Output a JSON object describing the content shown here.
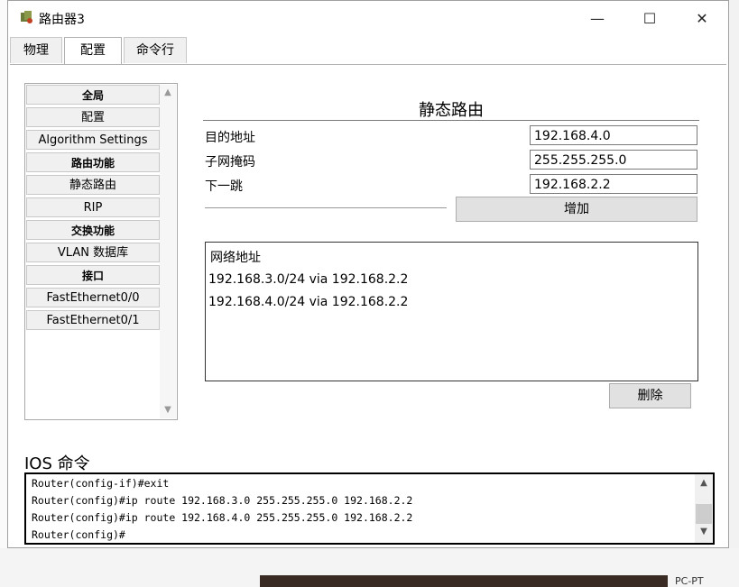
{
  "window": {
    "title": "路由器3",
    "icon": "router-icon",
    "controls": {
      "minimize": "—",
      "maximize": "☐",
      "close": "✕"
    }
  },
  "tabs": [
    {
      "label": "物理"
    },
    {
      "label": "配置"
    },
    {
      "label": "命令行"
    }
  ],
  "active_tab": "配置",
  "sidebar": {
    "items": [
      {
        "label": "全局",
        "type": "header"
      },
      {
        "label": "配置",
        "type": "item"
      },
      {
        "label": "Algorithm Settings",
        "type": "item"
      },
      {
        "label": "路由功能",
        "type": "header"
      },
      {
        "label": "静态路由",
        "type": "item"
      },
      {
        "label": "RIP",
        "type": "item"
      },
      {
        "label": "交换功能",
        "type": "header"
      },
      {
        "label": "VLAN 数据库",
        "type": "item"
      },
      {
        "label": "接口",
        "type": "header"
      },
      {
        "label": "FastEthernet0/0",
        "type": "item"
      },
      {
        "label": "FastEthernet0/1",
        "type": "item"
      }
    ]
  },
  "static_route": {
    "title": "静态路由",
    "network_label": "目的地址",
    "network_value": "192.168.4.0",
    "mask_label": "子网掩码",
    "mask_value": "255.255.255.0",
    "nexthop_label": "下一跳",
    "nexthop_value": "192.168.2.2",
    "add_button": "增加",
    "list_header": "网络地址",
    "routes": [
      "192.168.3.0/24 via 192.168.2.2",
      "192.168.4.0/24 via 192.168.2.2"
    ],
    "remove_button": "删除"
  },
  "ios": {
    "label": "IOS 命令",
    "lines": [
      "Router(config-if)#exit",
      "Router(config)#ip route 192.168.3.0 255.255.255.0 192.168.2.2",
      "Router(config)#ip route 192.168.4.0 255.255.255.0 192.168.2.2",
      "Router(config)#"
    ]
  },
  "background": {
    "pc_label": "PC-PT"
  }
}
